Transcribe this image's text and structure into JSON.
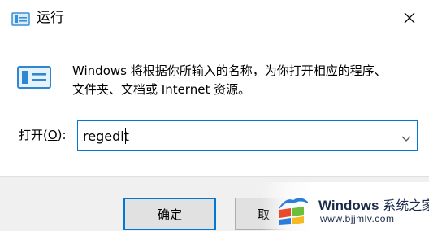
{
  "window": {
    "title": "运行",
    "icon": "run-icon",
    "close_icon": "close-icon"
  },
  "description": {
    "line1": "Windows 将根据你所输入的名称，为你打开相应的程序、",
    "line2": "文件夹、文档或 Internet 资源。"
  },
  "open_field": {
    "label_prefix": "打开(",
    "label_accel": "O",
    "label_suffix": "):",
    "value": "regedit",
    "dropdown_icon": "chevron-down-icon"
  },
  "buttons": {
    "ok_label": "确定",
    "cancel_label": "取"
  },
  "watermark": {
    "brand": "Windows",
    "brand_cn": "系统之家",
    "url": "www.bjjmlv.com"
  },
  "colors": {
    "accent": "#0078d7",
    "button_face": "#e1e1e1",
    "button_bar": "#f0f0f0"
  }
}
